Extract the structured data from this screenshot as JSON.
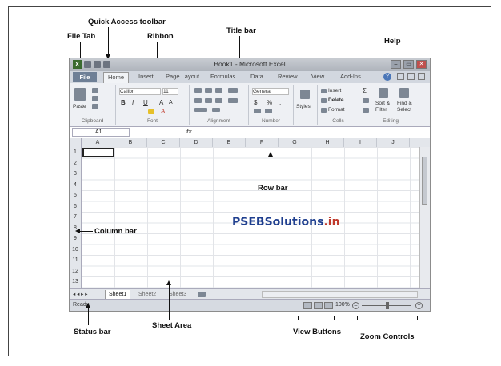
{
  "callouts": {
    "quick_access": "Quick Access toolbar",
    "file_tab": "File Tab",
    "ribbon": "Ribbon",
    "title_bar": "Title bar",
    "help": "Help",
    "row_bar": "Row bar",
    "column_bar": "Column bar",
    "status_bar": "Status bar",
    "sheet_area": "Sheet Area",
    "view_buttons": "View Buttons",
    "zoom_controls": "Zoom Controls"
  },
  "window": {
    "title": "Book1 - Microsoft Excel",
    "app_icon": "X",
    "minimize": "–",
    "restore": "▭",
    "close": "✕"
  },
  "tabs": {
    "file": "File",
    "home": "Home",
    "insert": "Insert",
    "page_layout": "Page Layout",
    "formulas": "Formulas",
    "data": "Data",
    "review": "Review",
    "view": "View",
    "addins": "Add-Ins"
  },
  "ribbon": {
    "paste": "Paste",
    "font_name": "Calibri",
    "font_size": "11",
    "bold": "B",
    "italic": "I",
    "underline": "U",
    "grow_font": "A",
    "shrink_font": "A",
    "font_color": "A",
    "number_format": "General",
    "dollar": "$",
    "percent": "%",
    "comma": ",",
    "styles": "Styles",
    "insert": "Insert",
    "delete": "Delete",
    "format": "Format",
    "sigma": "Σ",
    "sort": "Sort &",
    "filter": "Filter",
    "find": "Find &",
    "select": "Select",
    "groups": {
      "clipboard": "Clipboard",
      "font": "Font",
      "alignment": "Alignment",
      "number": "Number",
      "cells": "Cells",
      "editing": "Editing"
    }
  },
  "formula_bar": {
    "name_box": "A1",
    "fx": "fx"
  },
  "columns": [
    "A",
    "B",
    "C",
    "D",
    "E",
    "F",
    "G",
    "H",
    "I",
    "J"
  ],
  "rows": [
    "1",
    "2",
    "3",
    "4",
    "5",
    "6",
    "7",
    "8",
    "9",
    "10",
    "11",
    "12",
    "13"
  ],
  "sheets": {
    "nav": "◂ ◂ ▸ ▸",
    "tabs": [
      "Sheet1",
      "Sheet2",
      "Sheet3"
    ]
  },
  "status_bar": {
    "status": "Ready",
    "zoom": "100%",
    "zoom_minus": "–",
    "zoom_plus": "+"
  },
  "watermark": {
    "main": "PSEBSolutions",
    "suffix": ".in"
  }
}
